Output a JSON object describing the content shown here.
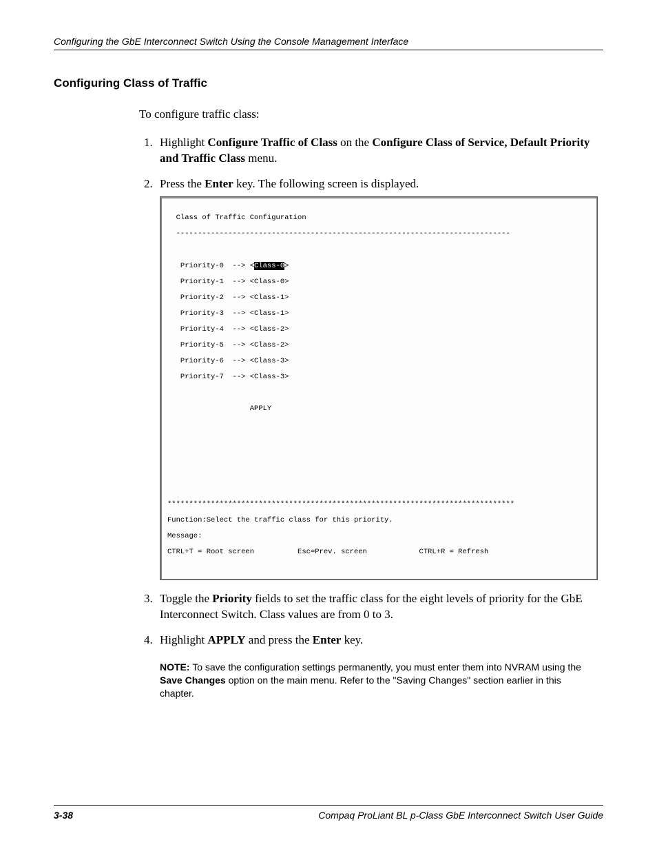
{
  "header": {
    "running_head": "Configuring the GbE Interconnect Switch Using the Console Management Interface"
  },
  "section": {
    "title": "Configuring Class of Traffic",
    "intro": "To configure traffic class:",
    "step1": {
      "pre": "Highlight ",
      "b1": "Configure Traffic of Class",
      "mid": " on the ",
      "b2": "Configure Class of Service, Default Priority and Traffic Class",
      "post": " menu."
    },
    "step2": {
      "pre": "Press the ",
      "b1": "Enter",
      "post": " key. The following screen is displayed."
    },
    "step3": {
      "pre": "Toggle the ",
      "b1": "Priority",
      "post": " fields to set the traffic class for the eight levels of priority for the GbE Interconnect Switch. Class values are from 0 to 3."
    },
    "step4": {
      "pre": "Highlight ",
      "b1": "APPLY",
      "mid": " and press the ",
      "b2": "Enter",
      "post": " key."
    },
    "note": {
      "lead": "NOTE:",
      "body_a": "  To save the configuration settings permanently, you must enter them into NVRAM using the ",
      "bold": "Save Changes",
      "body_b": " option on the main menu. Refer to the \"Saving Changes\" section earlier in this chapter."
    }
  },
  "console": {
    "title_line": "  Class of Traffic Configuration",
    "rule": "  -----------------------------------------------------------------------------",
    "p0_pre": "   Priority-0  --> <",
    "p0_sel": "Class-0",
    "p0_post": ">",
    "p1": "   Priority-1  --> <Class-0>",
    "p2": "   Priority-2  --> <Class-1>",
    "p3": "   Priority-3  --> <Class-1>",
    "p4": "   Priority-4  --> <Class-2>",
    "p5": "   Priority-5  --> <Class-2>",
    "p6": "   Priority-6  --> <Class-3>",
    "p7": "   Priority-7  --> <Class-3>",
    "apply": "                   APPLY",
    "stars": "********************************************************************************",
    "func": "Function:Select the traffic class for this priority.",
    "msg": "Message:",
    "foot": "CTRL+T = Root screen          Esc=Prev. screen            CTRL+R = Refresh"
  },
  "footer": {
    "page": "3-38",
    "title": "Compaq ProLiant BL p-Class GbE Interconnect Switch User Guide"
  }
}
